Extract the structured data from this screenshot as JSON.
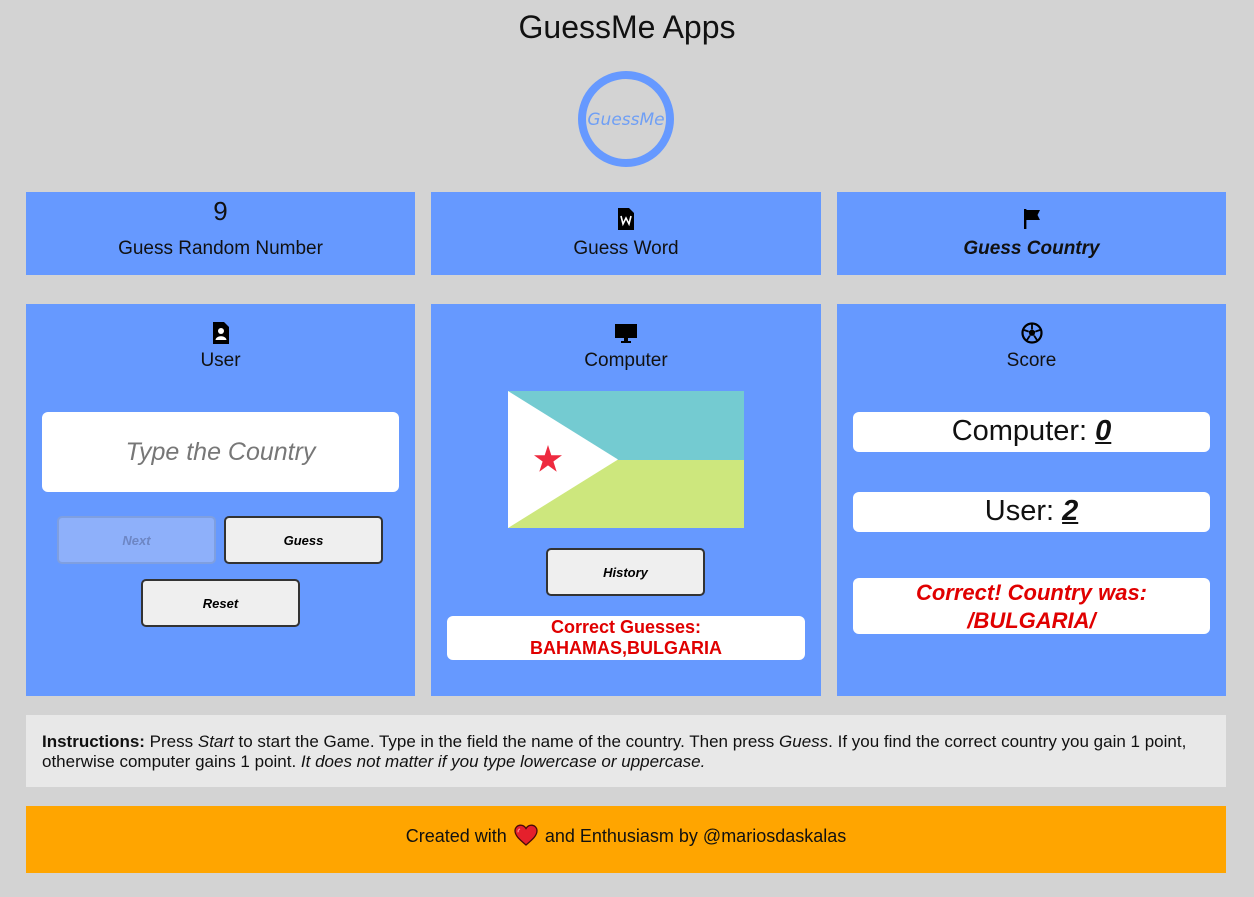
{
  "app": {
    "title": "GuessMe Apps",
    "logo_text": "GuessMe"
  },
  "nav": [
    {
      "id": "number",
      "icon": "digit-nine-icon",
      "glyph": "9",
      "label": "Guess Random Number"
    },
    {
      "id": "word",
      "icon": "word-document-icon",
      "label": "Guess Word"
    },
    {
      "id": "country",
      "icon": "flag-icon",
      "label": "Guess Country",
      "active": true
    }
  ],
  "user": {
    "icon": "user-card-icon",
    "heading": "User",
    "input_placeholder": "Type the Country",
    "input_value": "",
    "next_label": "Next",
    "guess_label": "Guess",
    "reset_label": "Reset"
  },
  "computer": {
    "icon": "monitor-icon",
    "heading": "Computer",
    "history_label": "History",
    "correct_guesses_prefix": "Correct Guesses:",
    "correct_guesses_value": "BAHAMAS,BULGARIA",
    "flag_colors": {
      "top": "#74cbd1",
      "bottom": "#cde77d",
      "triangle": "#ffffff",
      "star": "#ee2a3f"
    }
  },
  "score": {
    "icon": "soccer-ball-icon",
    "heading": "Score",
    "computer_label": "Computer:",
    "computer_value": "0",
    "user_label": "User:",
    "user_value": "2",
    "result_line1": "Correct! Country was:",
    "result_line2": "/BULGARIA/"
  },
  "instructions": {
    "label": "Instructions:",
    "t1": " Press ",
    "start_word": "Start",
    "t2": " to start the Game. Type in the field the name of the country. Then press ",
    "guess_word": "Guess",
    "t3": ". If you find the correct country you gain 1 point, otherwise computer gains 1 point. ",
    "note": "It does not matter if you type lowercase or uppercase."
  },
  "footer": {
    "pre": "Created with",
    "post": "and Enthusiasm by @mariosdaskalas",
    "heart_icon": "heart-icon"
  },
  "colors": {
    "background": "#d3d3d3",
    "panel": "#6699ff",
    "footer": "#ffa500",
    "error_red": "#e00000"
  }
}
